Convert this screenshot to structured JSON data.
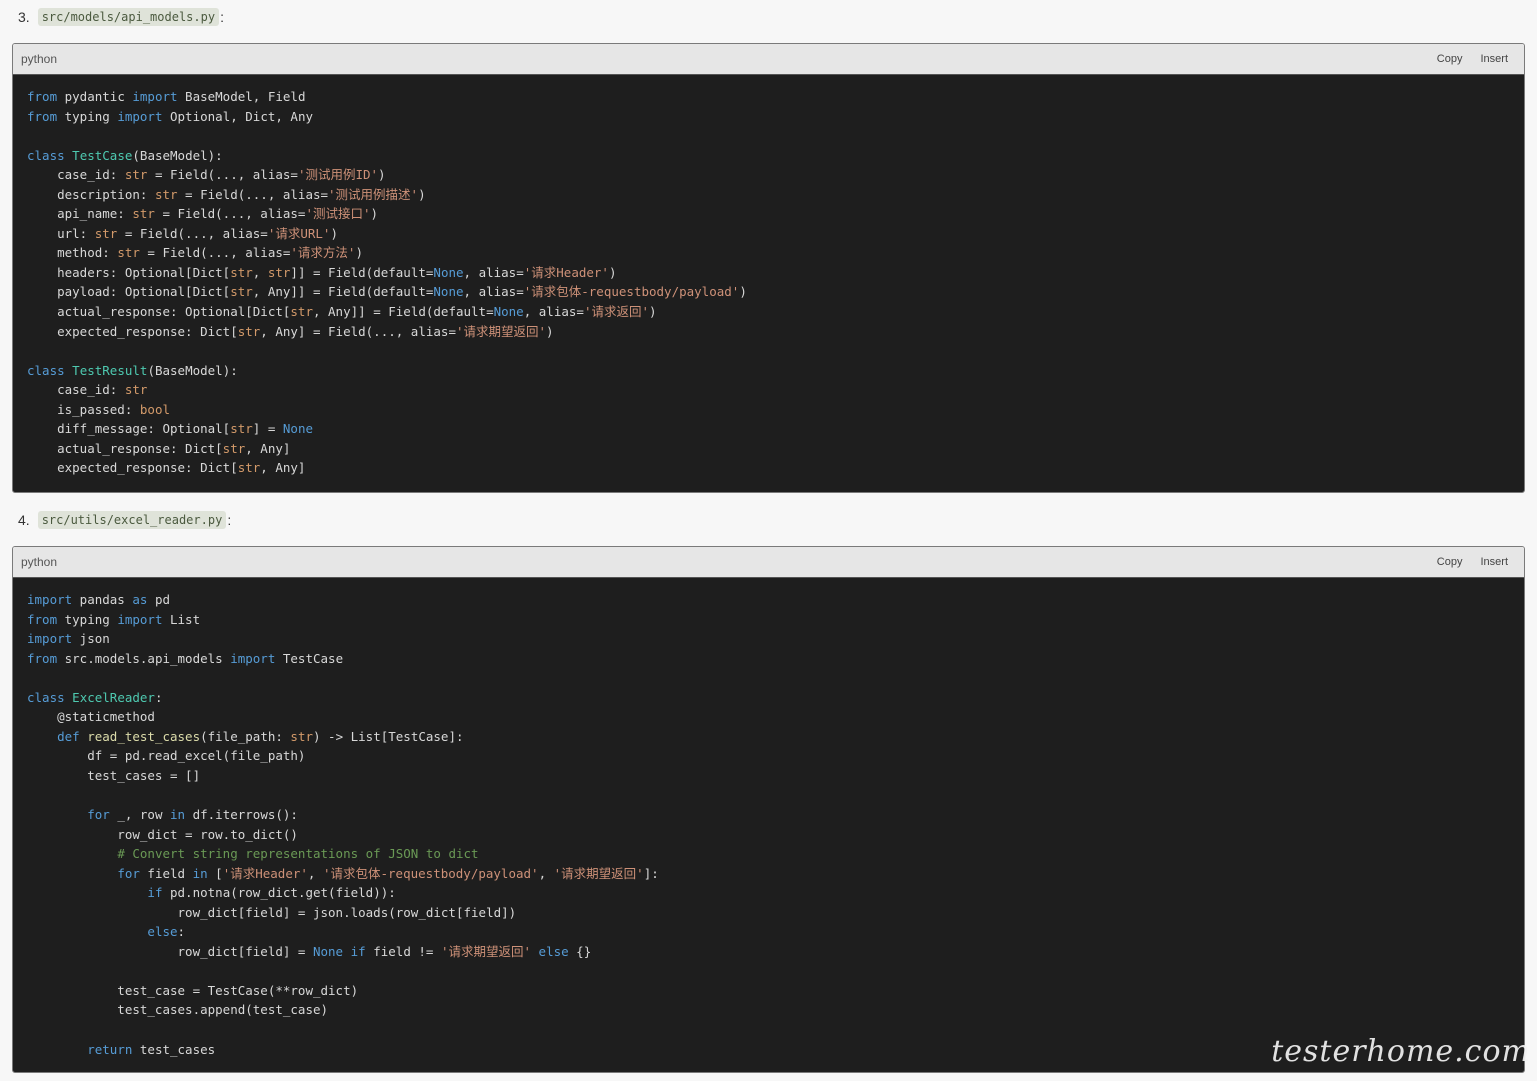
{
  "step3": {
    "number": "3.",
    "path": "src/models/api_models.py",
    "colon": ":"
  },
  "step4": {
    "number": "4.",
    "path": "src/utils/excel_reader.py",
    "colon": ":"
  },
  "block1": {
    "lang": "python",
    "copy": "Copy",
    "insert": "Insert"
  },
  "block2": {
    "lang": "python",
    "copy": "Copy",
    "insert": "Insert"
  },
  "code1": [
    [
      [
        "kw",
        "from"
      ],
      [
        "t",
        " pydantic "
      ],
      [
        "kw",
        "import"
      ],
      [
        "t",
        " BaseModel, Field"
      ]
    ],
    [
      [
        "kw",
        "from"
      ],
      [
        "t",
        " typing "
      ],
      [
        "kw",
        "import"
      ],
      [
        "t",
        " Optional, Dict, Any"
      ]
    ],
    [],
    [
      [
        "kw",
        "class"
      ],
      [
        "t",
        " "
      ],
      [
        "cls",
        "TestCase"
      ],
      [
        "t",
        "(BaseModel):"
      ]
    ],
    [
      [
        "t",
        "    case_id: "
      ],
      [
        "bi",
        "str"
      ],
      [
        "t",
        " = Field(..., alias="
      ],
      [
        "st",
        "'测试用例ID'"
      ],
      [
        "t",
        ")"
      ]
    ],
    [
      [
        "t",
        "    description: "
      ],
      [
        "bi",
        "str"
      ],
      [
        "t",
        " = Field(..., alias="
      ],
      [
        "st",
        "'测试用例描述'"
      ],
      [
        "t",
        ")"
      ]
    ],
    [
      [
        "t",
        "    api_name: "
      ],
      [
        "bi",
        "str"
      ],
      [
        "t",
        " = Field(..., alias="
      ],
      [
        "st",
        "'测试接口'"
      ],
      [
        "t",
        ")"
      ]
    ],
    [
      [
        "t",
        "    url: "
      ],
      [
        "bi",
        "str"
      ],
      [
        "t",
        " = Field(..., alias="
      ],
      [
        "st",
        "'请求URL'"
      ],
      [
        "t",
        ")"
      ]
    ],
    [
      [
        "t",
        "    method: "
      ],
      [
        "bi",
        "str"
      ],
      [
        "t",
        " = Field(..., alias="
      ],
      [
        "st",
        "'请求方法'"
      ],
      [
        "t",
        ")"
      ]
    ],
    [
      [
        "t",
        "    headers: Optional[Dict["
      ],
      [
        "bi",
        "str"
      ],
      [
        "t",
        ", "
      ],
      [
        "bi",
        "str"
      ],
      [
        "t",
        "]] = Field(default="
      ],
      [
        "kw",
        "None"
      ],
      [
        "t",
        ", alias="
      ],
      [
        "st",
        "'请求Header'"
      ],
      [
        "t",
        ")"
      ]
    ],
    [
      [
        "t",
        "    payload: Optional[Dict["
      ],
      [
        "bi",
        "str"
      ],
      [
        "t",
        ", Any]] = Field(default="
      ],
      [
        "kw",
        "None"
      ],
      [
        "t",
        ", alias="
      ],
      [
        "st",
        "'请求包体-requestbody/payload'"
      ],
      [
        "t",
        ")"
      ]
    ],
    [
      [
        "t",
        "    actual_response: Optional[Dict["
      ],
      [
        "bi",
        "str"
      ],
      [
        "t",
        ", Any]] = Field(default="
      ],
      [
        "kw",
        "None"
      ],
      [
        "t",
        ", alias="
      ],
      [
        "st",
        "'请求返回'"
      ],
      [
        "t",
        ")"
      ]
    ],
    [
      [
        "t",
        "    expected_response: Dict["
      ],
      [
        "bi",
        "str"
      ],
      [
        "t",
        ", Any] = Field(..., alias="
      ],
      [
        "st",
        "'请求期望返回'"
      ],
      [
        "t",
        ")"
      ]
    ],
    [],
    [
      [
        "kw",
        "class"
      ],
      [
        "t",
        " "
      ],
      [
        "cls",
        "TestResult"
      ],
      [
        "t",
        "(BaseModel):"
      ]
    ],
    [
      [
        "t",
        "    case_id: "
      ],
      [
        "bi",
        "str"
      ]
    ],
    [
      [
        "t",
        "    is_passed: "
      ],
      [
        "bi",
        "bool"
      ]
    ],
    [
      [
        "t",
        "    diff_message: Optional["
      ],
      [
        "bi",
        "str"
      ],
      [
        "t",
        "] = "
      ],
      [
        "kw",
        "None"
      ]
    ],
    [
      [
        "t",
        "    actual_response: Dict["
      ],
      [
        "bi",
        "str"
      ],
      [
        "t",
        ", Any]"
      ]
    ],
    [
      [
        "t",
        "    expected_response: Dict["
      ],
      [
        "bi",
        "str"
      ],
      [
        "t",
        ", Any]"
      ]
    ]
  ],
  "code2": [
    [
      [
        "kw",
        "import"
      ],
      [
        "t",
        " pandas "
      ],
      [
        "kw",
        "as"
      ],
      [
        "t",
        " pd"
      ]
    ],
    [
      [
        "kw",
        "from"
      ],
      [
        "t",
        " typing "
      ],
      [
        "kw",
        "import"
      ],
      [
        "t",
        " List"
      ]
    ],
    [
      [
        "kw",
        "import"
      ],
      [
        "t",
        " json"
      ]
    ],
    [
      [
        "kw",
        "from"
      ],
      [
        "t",
        " src.models.api_models "
      ],
      [
        "kw",
        "import"
      ],
      [
        "t",
        " TestCase"
      ]
    ],
    [],
    [
      [
        "kw",
        "class"
      ],
      [
        "t",
        " "
      ],
      [
        "cls",
        "ExcelReader"
      ],
      [
        "t",
        ":"
      ]
    ],
    [
      [
        "t",
        "    @staticmethod"
      ]
    ],
    [
      [
        "t",
        "    "
      ],
      [
        "kw",
        "def"
      ],
      [
        "t",
        " "
      ],
      [
        "fn",
        "read_test_cases"
      ],
      [
        "t",
        "(file_path: "
      ],
      [
        "bi",
        "str"
      ],
      [
        "t",
        ") -> List[TestCase]:"
      ]
    ],
    [
      [
        "t",
        "        df = pd.read_excel(file_path)"
      ]
    ],
    [
      [
        "t",
        "        test_cases = []"
      ]
    ],
    [],
    [
      [
        "t",
        "        "
      ],
      [
        "kw",
        "for"
      ],
      [
        "t",
        " _, row "
      ],
      [
        "kw",
        "in"
      ],
      [
        "t",
        " df.iterrows():"
      ]
    ],
    [
      [
        "t",
        "            row_dict = row.to_dict()"
      ]
    ],
    [
      [
        "t",
        "            "
      ],
      [
        "cm",
        "# Convert string representations of JSON to dict"
      ]
    ],
    [
      [
        "t",
        "            "
      ],
      [
        "kw",
        "for"
      ],
      [
        "t",
        " field "
      ],
      [
        "kw",
        "in"
      ],
      [
        "t",
        " ["
      ],
      [
        "st",
        "'请求Header'"
      ],
      [
        "t",
        ", "
      ],
      [
        "st",
        "'请求包体-requestbody/payload'"
      ],
      [
        "t",
        ", "
      ],
      [
        "st",
        "'请求期望返回'"
      ],
      [
        "t",
        "]:"
      ]
    ],
    [
      [
        "t",
        "                "
      ],
      [
        "kw",
        "if"
      ],
      [
        "t",
        " pd.notna(row_dict.get(field)):"
      ]
    ],
    [
      [
        "t",
        "                    row_dict[field] = json.loads(row_dict[field])"
      ]
    ],
    [
      [
        "t",
        "                "
      ],
      [
        "kw",
        "else"
      ],
      [
        "t",
        ":"
      ]
    ],
    [
      [
        "t",
        "                    row_dict[field] = "
      ],
      [
        "kw",
        "None"
      ],
      [
        "t",
        " "
      ],
      [
        "kw",
        "if"
      ],
      [
        "t",
        " field != "
      ],
      [
        "st",
        "'请求期望返回'"
      ],
      [
        "t",
        " "
      ],
      [
        "kw",
        "else"
      ],
      [
        "t",
        " {}"
      ]
    ],
    [],
    [
      [
        "t",
        "            test_case = TestCase(**row_dict)"
      ]
    ],
    [
      [
        "t",
        "            test_cases.append(test_case)"
      ]
    ],
    [],
    [
      [
        "t",
        "        "
      ],
      [
        "kw",
        "return"
      ],
      [
        "t",
        " test_cases"
      ]
    ]
  ],
  "watermark": "testerhome.com"
}
